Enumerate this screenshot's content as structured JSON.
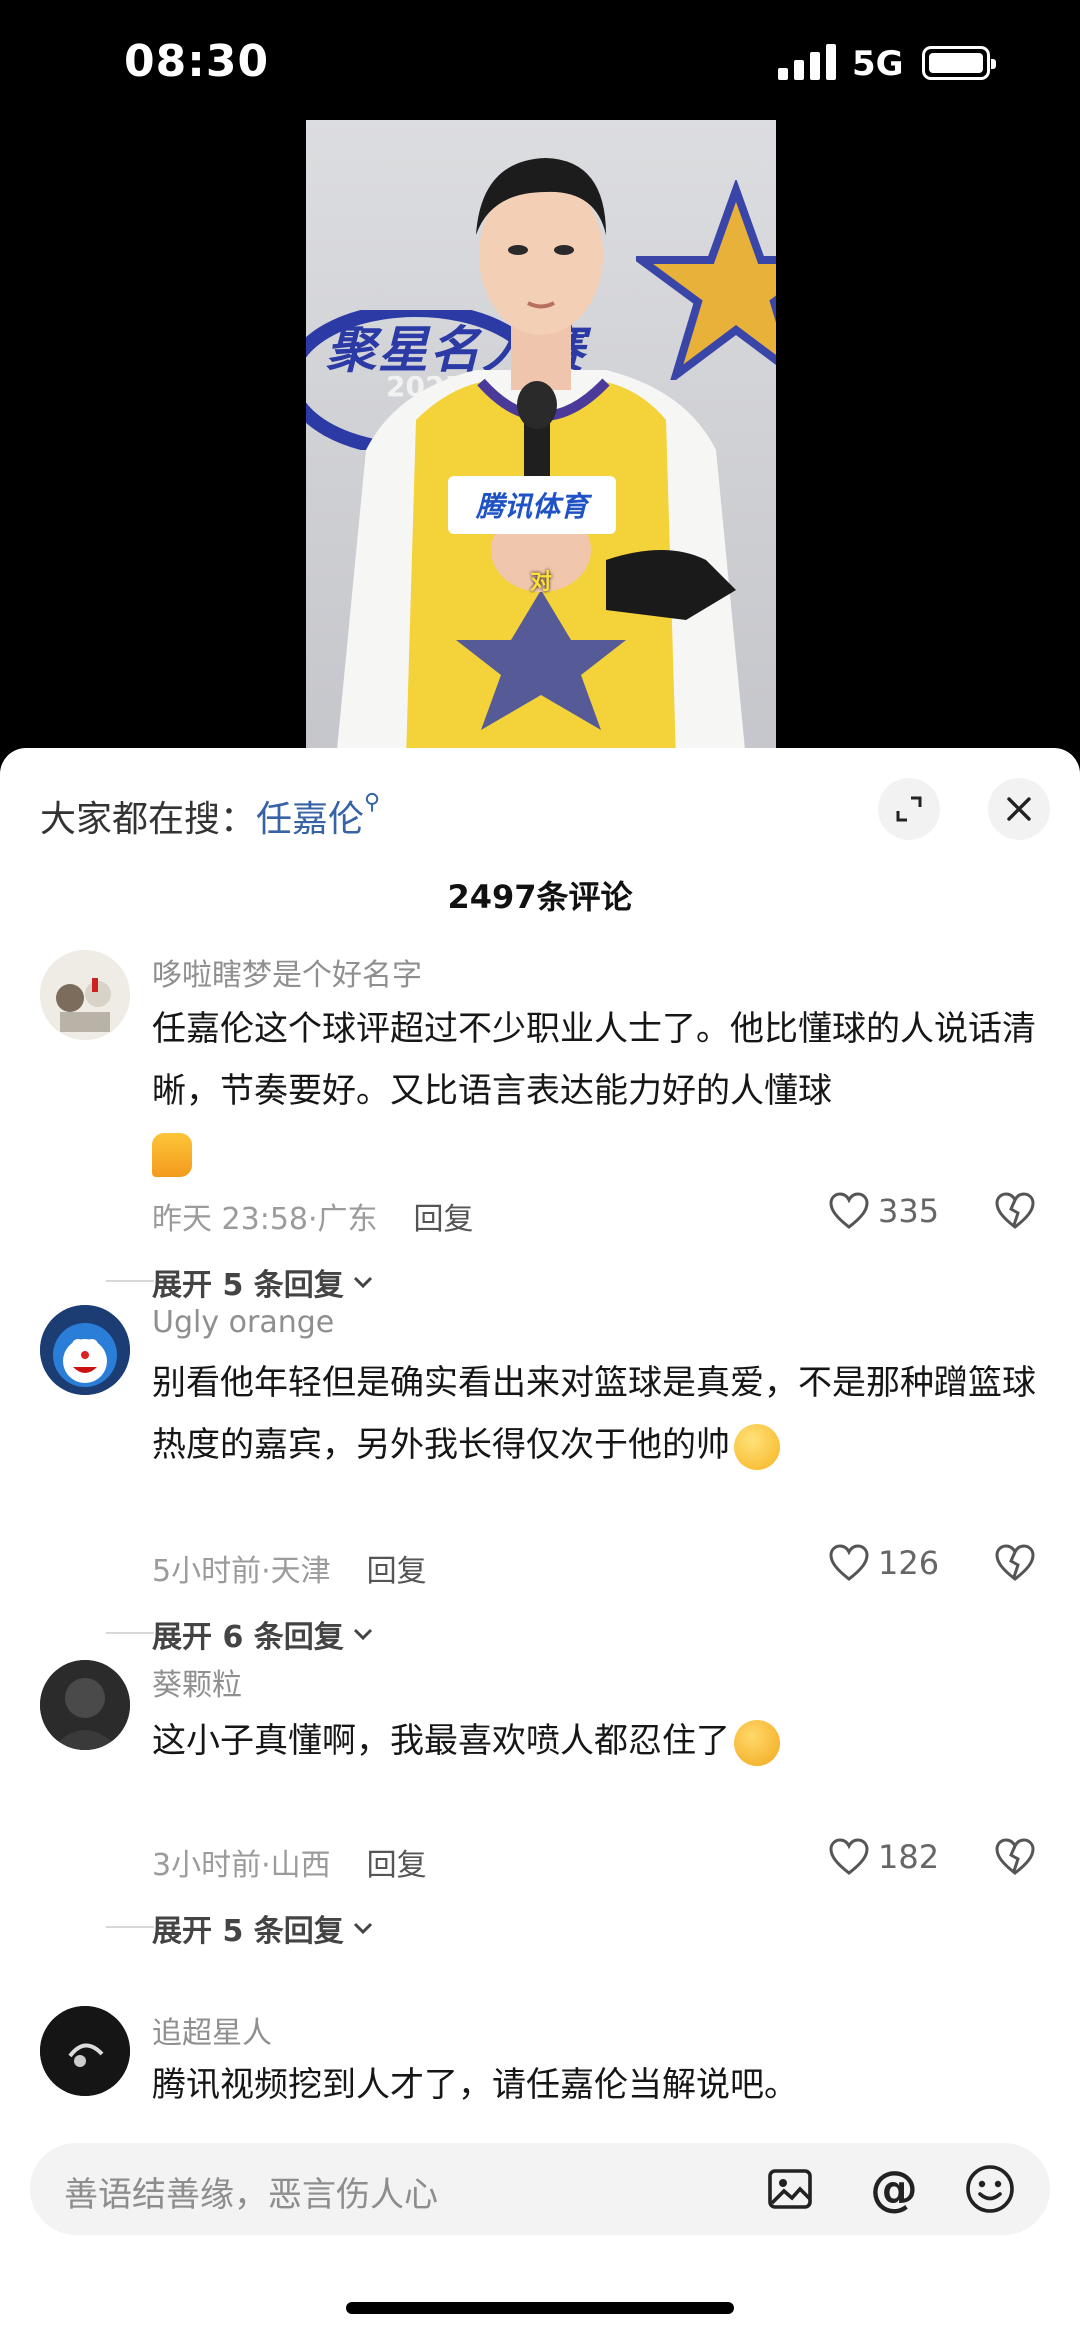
{
  "status_bar": {
    "time": "08:30",
    "network": "5G"
  },
  "video": {
    "event_title": "聚星名人赛",
    "event_year": "2025",
    "mic_brand": "腾讯体育",
    "subtitle": "对"
  },
  "sheet": {
    "search_prefix": "大家都在搜：",
    "search_term": "任嘉伦",
    "comment_count": "2497条评论",
    "comments": [
      {
        "user": "哆啦瞎梦是个好名字",
        "text": "任嘉伦这个球评超过不少职业人士了。他比懂球的人说话清晰，节奏要好。又比语言表达能力好的人懂球",
        "emoji": "thumbs-up",
        "time": "昨天 23:58",
        "location": "广东",
        "reply": "回复",
        "likes": "335",
        "expand": "展开 5 条回复"
      },
      {
        "user": "Ugly orange",
        "text": "别看他年轻但是确实看出来对篮球是真爱，不是那种蹭篮球热度的嘉宾，另外我长得仅次于他的帅",
        "emoji": "smug-face",
        "time": "5小时前",
        "location": "天津",
        "reply": "回复",
        "likes": "126",
        "expand": "展开 6 条回复"
      },
      {
        "user": "葵颗粒",
        "text": "这小子真懂啊，我最喜欢喷人都忍住了",
        "emoji": "holding-back-face",
        "time": "3小时前",
        "location": "山西",
        "reply": "回复",
        "likes": "182",
        "expand": "展开 5 条回复"
      },
      {
        "user": "追超星人",
        "text": "腾讯视频挖到人才了，请任嘉伦当解说吧。"
      }
    ]
  },
  "input": {
    "placeholder": "善语结善缘，恶言伤人心"
  },
  "colors": {
    "link_blue": "#3763a6",
    "sheet_bg": "#ffffff",
    "muted": "#9b9b9b"
  }
}
